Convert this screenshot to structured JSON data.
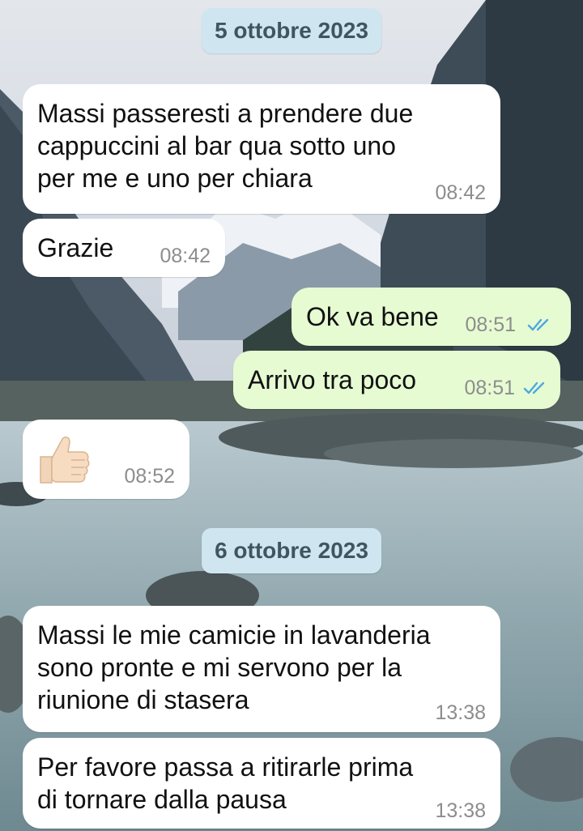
{
  "chat": {
    "date_separators": [
      "5 ottobre 2023",
      "6 ottobre 2023"
    ],
    "messages": [
      {
        "direction": "incoming",
        "text": "Massi passeresti a prendere due\ncappuccini al bar qua sotto uno\nper me e uno per chiara",
        "time": "08:42"
      },
      {
        "direction": "incoming",
        "text": "Grazie",
        "time": "08:42"
      },
      {
        "direction": "outgoing",
        "text": "Ok va bene",
        "time": "08:51",
        "status": "read-double-check"
      },
      {
        "direction": "outgoing",
        "text": "Arrivo tra poco",
        "time": "08:51",
        "status": "read-double-check"
      },
      {
        "direction": "incoming",
        "emoji": "thumbs-up-icon",
        "time": "08:52"
      },
      {
        "direction": "incoming",
        "text": "Massi le mie camicie in lavanderia\nsono pronte e mi servono per la\nriunione di stasera",
        "time": "13:38"
      },
      {
        "direction": "incoming",
        "text": "Per favore passa a ritirarle prima\ndi tornare dalla pausa",
        "time": "13:38"
      }
    ]
  },
  "colors": {
    "incoming_bubble": "#ffffff",
    "outgoing_bubble": "#e6fbd2",
    "date_pill": "#cfe6f1",
    "read_ticks": "#4fa8e0",
    "timestamp": "#8d8d8d"
  }
}
